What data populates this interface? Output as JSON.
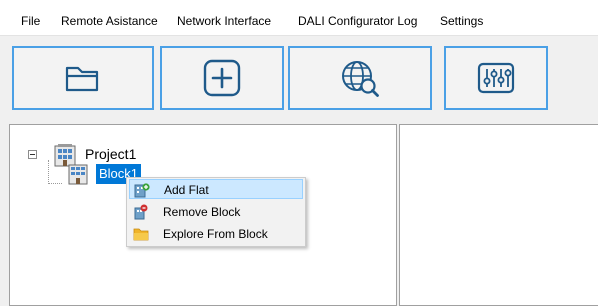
{
  "menu": {
    "items": [
      "File",
      "Remote Asistance",
      "Network Interface",
      "DALI Configurator Log",
      "Settings"
    ]
  },
  "toolbar": {
    "buttons": [
      {
        "icon": "folder-icon"
      },
      {
        "icon": "plus-icon"
      },
      {
        "icon": "globe-search-icon"
      },
      {
        "icon": "sliders-icon"
      }
    ]
  },
  "tree": {
    "project": {
      "label": "Project1",
      "icon": "building-icon"
    },
    "block": {
      "label": "Block1",
      "icon": "block-building-icon"
    }
  },
  "context_menu": {
    "items": [
      {
        "label": "Add Flat",
        "icon": "add-flat-icon"
      },
      {
        "label": "Remove Block",
        "icon": "remove-block-icon"
      },
      {
        "label": "Explore From Block",
        "icon": "folder-icon"
      }
    ]
  },
  "colors": {
    "accent": "#0078d7",
    "toolbar_border": "#4aa0e6",
    "menu_hover": "#cce8ff"
  }
}
